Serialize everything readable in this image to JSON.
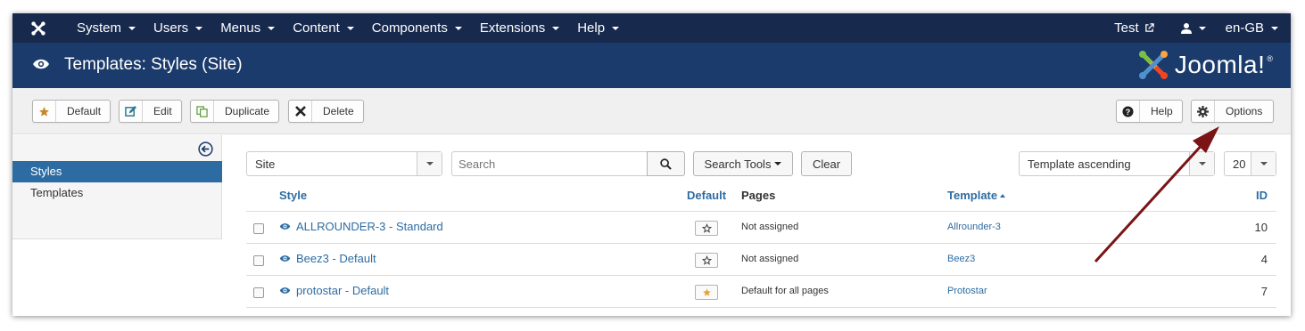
{
  "navbar": {
    "logo_icon": "joomla-icon",
    "menu": [
      {
        "label": "System"
      },
      {
        "label": "Users"
      },
      {
        "label": "Menus"
      },
      {
        "label": "Content"
      },
      {
        "label": "Components"
      },
      {
        "label": "Extensions"
      },
      {
        "label": "Help"
      }
    ],
    "site_link": "Test",
    "user_icon": "user-icon",
    "language": "en-GB"
  },
  "header": {
    "title": "Templates: Styles (Site)",
    "brand": "Joomla!",
    "brand_mark": "®"
  },
  "toolbar": {
    "default_label": "Default",
    "edit_label": "Edit",
    "duplicate_label": "Duplicate",
    "delete_label": "Delete",
    "help_label": "Help",
    "options_label": "Options"
  },
  "sidebar": {
    "items": [
      {
        "label": "Styles",
        "active": true
      },
      {
        "label": "Templates",
        "active": false
      }
    ]
  },
  "filters": {
    "client": "Site",
    "search_placeholder": "Search",
    "search_tools_label": "Search Tools",
    "clear_label": "Clear",
    "ordering": "Template ascending",
    "limit": "20"
  },
  "table": {
    "headers": {
      "style": "Style",
      "default": "Default",
      "pages": "Pages",
      "template": "Template",
      "id": "ID"
    },
    "rows": [
      {
        "style": "ALLROUNDER-3 - Standard",
        "is_default": false,
        "pages": "Not assigned",
        "template": "Allrounder-3",
        "id": "10"
      },
      {
        "style": "Beez3 - Default",
        "is_default": false,
        "pages": "Not assigned",
        "template": "Beez3",
        "id": "4"
      },
      {
        "style": "protostar - Default",
        "is_default": true,
        "pages": "Default for all pages",
        "template": "Protostar",
        "id": "7"
      }
    ]
  },
  "colors": {
    "navbar_bg": "#17294d",
    "header_bg": "#1b3b6c",
    "link": "#2d6ca2",
    "default_star": "#e5a531",
    "annotation_arrow": "#7a1416"
  }
}
